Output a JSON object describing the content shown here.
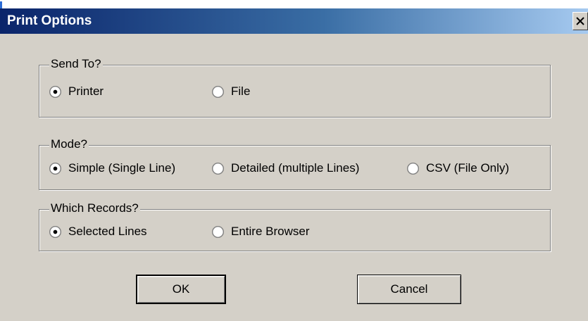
{
  "window": {
    "title": "Print Options",
    "close_glyph": "×"
  },
  "send_to": {
    "legend": "Send To?",
    "options": [
      {
        "label": "Printer",
        "selected": true
      },
      {
        "label": "File",
        "selected": false
      }
    ]
  },
  "mode": {
    "legend": "Mode?",
    "options": [
      {
        "label": "Simple (Single Line)",
        "selected": true
      },
      {
        "label": "Detailed (multiple Lines)",
        "selected": false
      },
      {
        "label": "CSV (File Only)",
        "selected": false
      }
    ]
  },
  "records": {
    "legend": "Which Records?",
    "options": [
      {
        "label": "Selected Lines",
        "selected": true
      },
      {
        "label": "Entire Browser",
        "selected": false
      }
    ]
  },
  "buttons": {
    "ok_label": "OK",
    "cancel_label": "Cancel"
  },
  "colors": {
    "face": "#d4d0c8",
    "title_start": "#0a246a",
    "title_end": "#a6caf0"
  }
}
